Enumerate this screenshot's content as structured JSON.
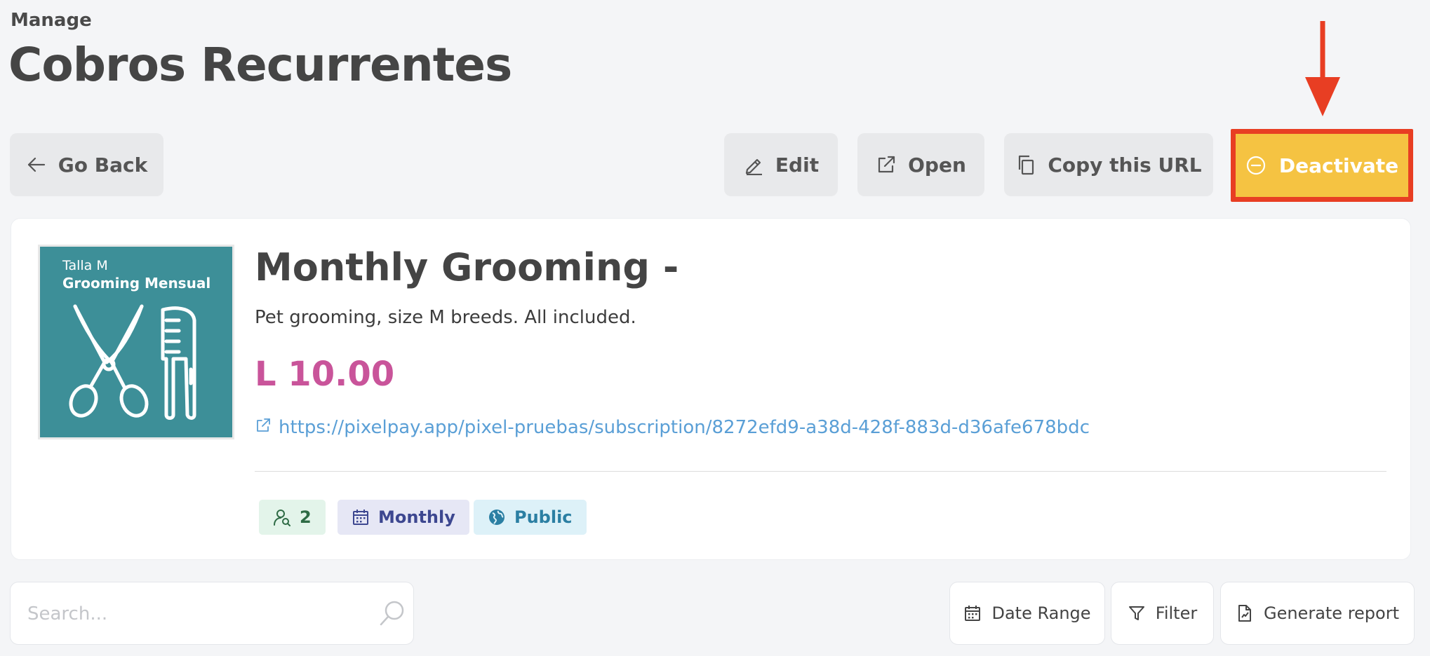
{
  "header": {
    "eyebrow": "Manage",
    "title": "Cobros Recurrentes"
  },
  "toolbar": {
    "back_label": "Go Back",
    "edit_label": "Edit",
    "open_label": "Open",
    "copy_label": "Copy this URL",
    "deactivate_label": "Deactivate"
  },
  "product": {
    "image": {
      "subtitle": "Talla M",
      "title": "Grooming Mensual",
      "background_color": "#3d8f98"
    },
    "title": "Monthly Grooming -",
    "description": "Pet grooming, size M breeds. All included.",
    "price": "L 10.00",
    "url": "https://pixelpay.app/pixel-pruebas/subscription/8272efd9-a38d-428f-883d-d36afe678bdc",
    "chips": {
      "subscribers": "2",
      "frequency": "Monthly",
      "visibility": "Public"
    }
  },
  "search": {
    "placeholder": "Search..."
  },
  "actions": {
    "date_range_label": "Date Range",
    "filter_label": "Filter",
    "report_label": "Generate report"
  },
  "colors": {
    "price": "#c9549a",
    "link": "#5a9fd6",
    "deactivate_bg": "#f5c342",
    "highlight_border": "#e83e23"
  }
}
